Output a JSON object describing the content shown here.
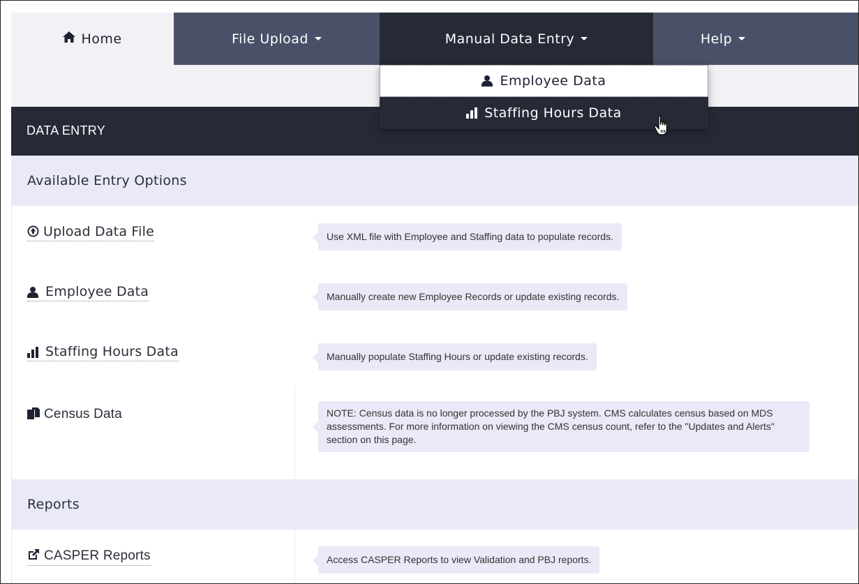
{
  "nav": {
    "home_label": "Home",
    "file_upload_label": "File Upload",
    "manual_entry_label": "Manual Data Entry",
    "help_label": "Help"
  },
  "dropdown": {
    "employee_label": "Employee Data",
    "staffing_label": "Staffing Hours Data"
  },
  "panel": {
    "title": "DATA ENTRY"
  },
  "sections": {
    "entry_options": "Available Entry Options",
    "reports": "Reports"
  },
  "rows": [
    {
      "label": "Upload Data File",
      "icon": "upload-circle-icon",
      "tip": "Use XML file with Employee and Staffing data to populate records."
    },
    {
      "label": "Employee Data",
      "icon": "user-icon",
      "tip": "Manually create new Employee Records or update existing records."
    },
    {
      "label": "Staffing Hours Data",
      "icon": "bar-chart-icon",
      "tip": "Manually populate Staffing Hours or update existing records."
    },
    {
      "label": "Census Data",
      "icon": "documents-icon",
      "tip": "NOTE: Census data is no longer processed by the PBJ system. CMS calculates census based on MDS assessments. For more information on viewing the CMS census count, refer to the \"Updates and Alerts\" section on this page."
    },
    {
      "label": "CASPER Reports",
      "icon": "external-edit-icon",
      "tip": "Access CASPER Reports to view Validation and PBJ reports."
    }
  ],
  "colors": {
    "nav_bg": "#4a5068",
    "nav_active_bg": "#262a37",
    "section_bg": "#eaeaf7",
    "tip_bg": "#e9e9f7"
  }
}
